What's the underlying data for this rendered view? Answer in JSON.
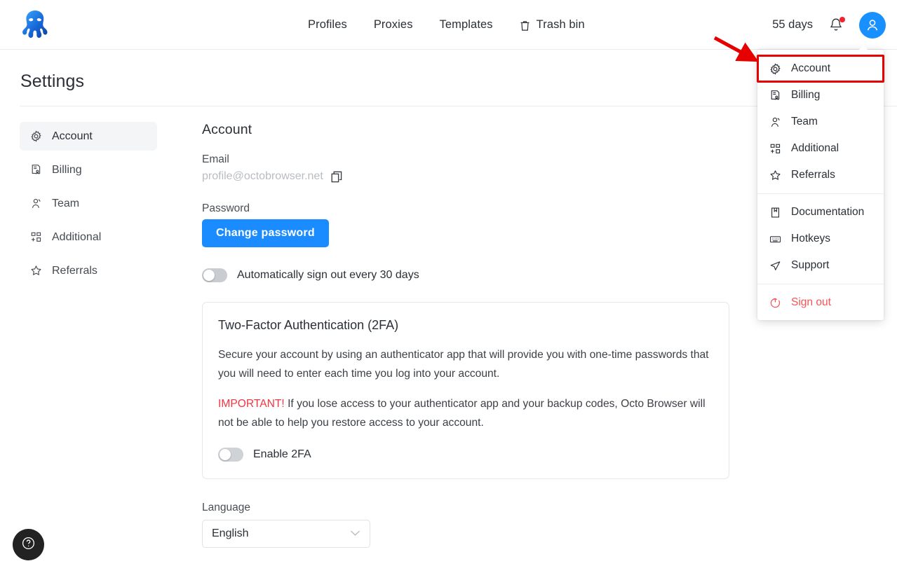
{
  "header": {
    "logo_name": "octo-browser-logo",
    "nav": [
      {
        "label": "Profiles",
        "icon": ""
      },
      {
        "label": "Proxies",
        "icon": ""
      },
      {
        "label": "Templates",
        "icon": ""
      },
      {
        "label": "Trash bin",
        "icon": "trash-icon"
      }
    ],
    "days_remaining": "55 days",
    "bell_icon": "notification-bell-icon",
    "bell_has_badge": true,
    "avatar_icon": "user-avatar-icon"
  },
  "dropdown": {
    "group1": [
      {
        "label": "Account",
        "icon": "gear-icon",
        "highlighted": true
      },
      {
        "label": "Billing",
        "icon": "billing-document-icon"
      },
      {
        "label": "Team",
        "icon": "team-people-icon"
      },
      {
        "label": "Additional",
        "icon": "grid-plus-icon"
      },
      {
        "label": "Referrals",
        "icon": "star-icon"
      }
    ],
    "group2": [
      {
        "label": "Documentation",
        "icon": "book-icon"
      },
      {
        "label": "Hotkeys",
        "icon": "keyboard-icon"
      },
      {
        "label": "Support",
        "icon": "send-icon"
      }
    ],
    "group3": [
      {
        "label": "Sign out",
        "icon": "sign-out-icon"
      }
    ],
    "highlight_color": "#e60000",
    "signout_color": "#fa5252"
  },
  "page": {
    "title": "Settings"
  },
  "sidebar": {
    "items": [
      {
        "label": "Account",
        "icon": "gear-icon",
        "active": true
      },
      {
        "label": "Billing",
        "icon": "billing-document-icon",
        "active": false
      },
      {
        "label": "Team",
        "icon": "team-people-icon",
        "active": false
      },
      {
        "label": "Additional",
        "icon": "grid-plus-icon",
        "active": false
      },
      {
        "label": "Referrals",
        "icon": "star-icon",
        "active": false
      }
    ]
  },
  "account": {
    "section_title": "Account",
    "email_label": "Email",
    "email_value": "profile@octobrowser.net",
    "copy_icon": "copy-icon",
    "password_label": "Password",
    "change_password_button": "Change password",
    "autosignout_label": "Automatically sign out every 30 days",
    "autosignout_enabled": false,
    "twofa": {
      "title": "Two-Factor Authentication (2FA)",
      "description": "Secure your account by using an authenticator app that will provide you with one-time passwords that you will need to enter each time you log into your account.",
      "important_prefix": "IMPORTANT!",
      "important_text": " If you lose access to your authenticator app and your backup codes, Octo Browser will not be able to help you restore access to your account.",
      "toggle_label": "Enable 2FA",
      "toggle_enabled": false
    },
    "language_label": "Language",
    "language_value": "English",
    "language_chevron": "chevron-down-icon"
  },
  "help": {
    "icon": "question-mark-help-icon"
  },
  "colors": {
    "accent": "#1a8cff",
    "danger": "#f5333f",
    "annotation": "#e60000",
    "avatar": "#1890ff"
  }
}
